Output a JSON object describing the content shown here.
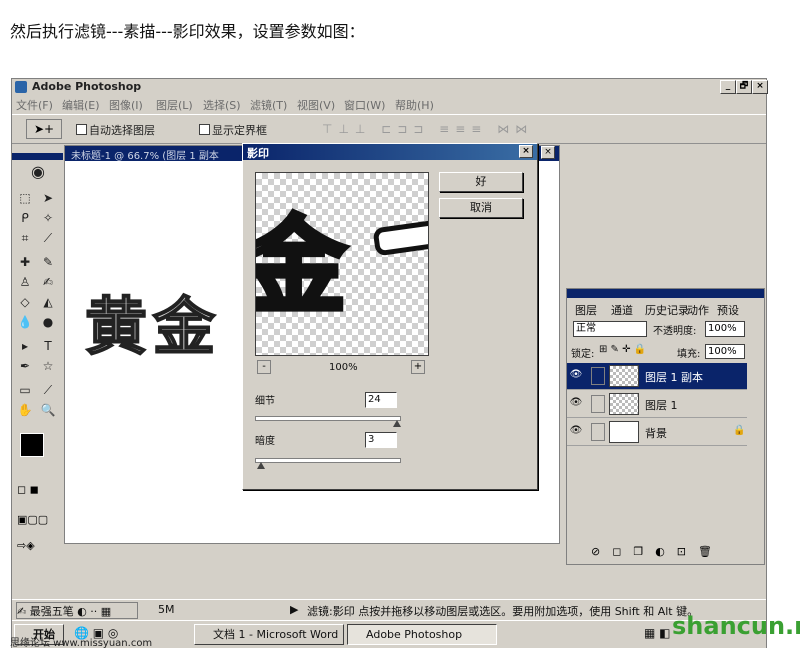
{
  "caption": "然后执行滤镜---素描---影印效果，设置参数如图：",
  "app": {
    "title": "Adobe Photoshop",
    "controls": [
      "_",
      "🗗",
      "×"
    ],
    "menu": [
      "文件(F)",
      "编辑(E)",
      "图像(I)",
      "图层(L)",
      "选择(S)",
      "滤镜(T)",
      "视图(V)",
      "窗口(W)",
      "帮助(H)"
    ],
    "options": {
      "auto_select_layer": "自动选择图层",
      "show_bounds": "显示定界框"
    }
  },
  "document": {
    "title": "未标题-1 @ 66.7% (图层 1 副本",
    "canvas_text": "黄金"
  },
  "dialog": {
    "title": "影印",
    "ok": "好",
    "cancel": "取消",
    "preview_text": "金",
    "zoom": "100%",
    "zoom_minus": "-",
    "zoom_plus": "+",
    "detail_label": "细节",
    "detail_value": "24",
    "darkness_label": "暗度",
    "darkness_value": "3"
  },
  "layers_panel": {
    "tabs": [
      "图层",
      "通道",
      "历史记录",
      "动作",
      "预设"
    ],
    "blend_mode": "正常",
    "opacity_label": "不透明度:",
    "opacity_value": "100%",
    "lock_label": "锁定:",
    "fill_label": "填充:",
    "fill_value": "100%",
    "layers": [
      {
        "name": "图层 1 副本",
        "selected": true
      },
      {
        "name": "图层 1",
        "selected": false
      },
      {
        "name": "背景",
        "selected": false
      }
    ]
  },
  "status": {
    "size": "5M",
    "message": "滤镜:影印  点按并拖移以移动图层或选区。要用附加选项，使用 Shift 和 Alt 键。",
    "ime": "最强五笔"
  },
  "taskbar": {
    "start": "开始",
    "tasks": [
      "文档 1 - Microsoft Word",
      "Adobe Photoshop"
    ]
  },
  "watermarks": {
    "left": "思缘论坛 www.missyuan.com",
    "right": "shancun.net"
  }
}
